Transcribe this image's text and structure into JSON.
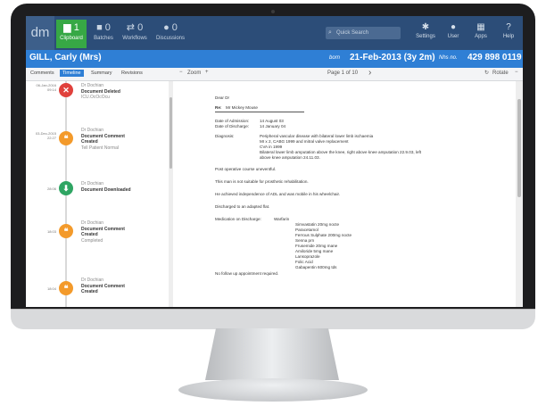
{
  "app": {
    "logo": "dm",
    "nav": [
      {
        "count": "1",
        "label": "Clipboard",
        "icon": "document-icon",
        "active": true
      },
      {
        "count": "0",
        "label": "Batches",
        "icon": "folder-icon"
      },
      {
        "count": "0",
        "label": "Workflows",
        "icon": "workflow-icon"
      },
      {
        "count": "0",
        "label": "Discussions",
        "icon": "chat-icon"
      }
    ],
    "search_placeholder": "Quick Search",
    "right": [
      {
        "label": "Settings",
        "icon": "gear-icon"
      },
      {
        "label": "User",
        "icon": "user-icon"
      },
      {
        "label": "Apps",
        "icon": "grid-icon"
      },
      {
        "label": "Help",
        "icon": "help-icon"
      }
    ]
  },
  "patient": {
    "name": "GILL, Carly (Mrs)",
    "born_label": "born",
    "born": "21-Feb-2013 (3y 2m)",
    "nhs_label": "Nhs no.",
    "nhs": "429 898 0119"
  },
  "tabs": [
    "Comments",
    "Timeline",
    "Summary",
    "Revisions"
  ],
  "active_tab": "Timeline",
  "doc_toolbar": {
    "zoom_minus": "−",
    "zoom": "Zoom",
    "zoom_plus": "+",
    "page": "Page 1 of 10",
    "next": "›",
    "rotate": "Rotate"
  },
  "timeline": [
    {
      "ts": "06-Jan-2016\n09:14",
      "who": "Dr Dochian",
      "title": "Document Deleted",
      "sub": "ICU.OcOcOcu",
      "color": "#e0413c",
      "glyph": "✕"
    },
    {
      "ts": "03-Dec-2015\n22:27",
      "who": "Dr Dochian",
      "title": "Document Comment\nCreated",
      "sub": "Tell Patient Normal",
      "color": "#f39a2b",
      "glyph": "❝"
    },
    {
      "ts": "28:06",
      "who": "Dr Dochian",
      "title": "Document Downloaded",
      "sub": "",
      "color": "#2fa563",
      "glyph": "⬇"
    },
    {
      "ts": "18:03",
      "who": "Dr Dochian",
      "title": "Document Comment\nCreated",
      "sub": "Completed",
      "color": "#f39a2b",
      "glyph": "❝"
    },
    {
      "ts": "18:04",
      "who": "Dr Dochian",
      "title": "Document Comment\nCreated",
      "sub": "",
      "color": "#f39a2b",
      "glyph": "❝"
    }
  ],
  "letter": {
    "greeting": "Dear Dr",
    "re_label": "Re:",
    "re_value": "Mr Mickey Mouse",
    "adm_label": "Date of Admission:",
    "adm_value": "14 August 03",
    "dis_label": "Date of Discharge:",
    "dis_value": "14 January 04",
    "diag_label": "Diagnosis:",
    "diag_lines": [
      "Peripheral vascular disease with bilateral lower limb ischaemia",
      "MI x 2, CABG 1999 and mitral valve replacement",
      "CVA in 1999",
      "Bilateral lower limb amputation above the knee, right above knee amputation 22.9.03, left",
      "above knee amputation 24.11.03."
    ],
    "para1": "Post operative course uneventful.",
    "para2": "This man is not suitable for prosthetic rehabilitation.",
    "para3": "He achieved independence of ADL and was mobile in his wheelchair.",
    "para4": "Discharged to an adapted flat.",
    "med_label": "Medication on Discharge:",
    "med_first": "Warfarin",
    "meds": [
      "Simvastatin 20mg nocte",
      "Paracetamol",
      "Ferrous Sulphate 200mg nocte",
      "Senna prn",
      "Frusemide 20mg mane",
      "Amiloride 5mg mane",
      "Lansoprazole",
      "Folic Acid",
      "Gabapentin 600mg tds"
    ],
    "followup": "No follow up appointment required."
  }
}
